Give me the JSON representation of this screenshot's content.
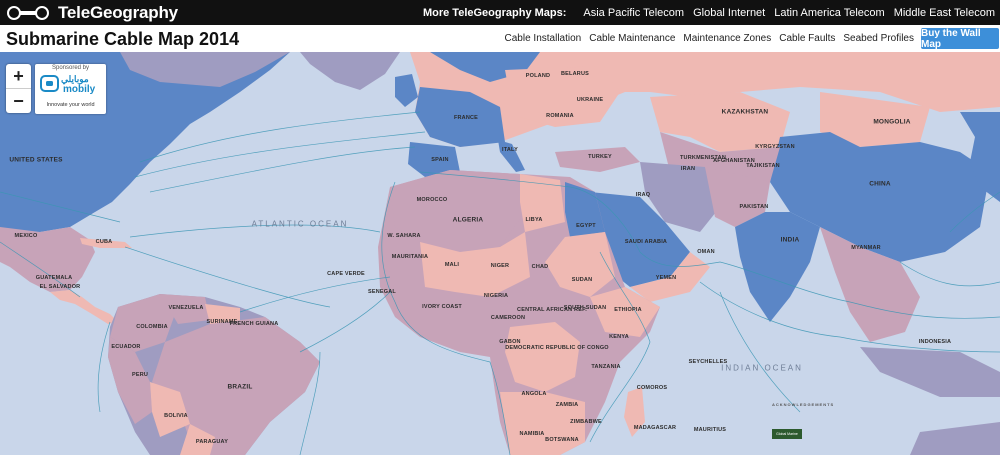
{
  "header": {
    "logo_text": "TeleGeography",
    "more_label": "More TeleGeography Maps:",
    "more_links": [
      "Asia Pacific Telecom",
      "Global Internet",
      "Latin America Telecom",
      "Middle East Telecom"
    ]
  },
  "titlebar": {
    "title": "Submarine Cable Map 2014",
    "tabs": [
      "Cable Installation",
      "Cable Maintenance",
      "Maintenance Zones",
      "Cable Faults",
      "Seabed Profiles"
    ],
    "buy_label": "Buy the Wall Map"
  },
  "map": {
    "zoom_in": "+",
    "zoom_out": "−",
    "sponsor": {
      "label": "Sponsored by",
      "brand_arabic": "موبايلي",
      "brand": "mobily",
      "tagline": "Innovate your world"
    },
    "oceans": [
      "ATLANTIC OCEAN",
      "INDIAN OCEAN"
    ],
    "countries": {
      "united_states": "UNITED STATES",
      "mexico": "MEXICO",
      "cuba": "CUBA",
      "guatemala": "GUATEMALA",
      "el_salvador": "EL SALVADOR",
      "venezuela": "VENEZUELA",
      "colombia": "COLOMBIA",
      "suriname": "SURINAME",
      "french_guiana": "FRENCH GUIANA",
      "ecuador": "ECUADOR",
      "peru": "PERU",
      "brazil": "BRAZIL",
      "bolivia": "BOLIVIA",
      "paraguay": "PARAGUAY",
      "poland": "POLAND",
      "belarus": "BELARUS",
      "ukraine": "UKRAINE",
      "romania": "ROMANIA",
      "france": "FRANCE",
      "spain": "SPAIN",
      "italy": "ITALY",
      "turkey": "TURKEY",
      "kazakhstan": "KAZAKHSTAN",
      "mongolia": "MONGOLIA",
      "china": "CHINA",
      "turkmenistan": "TURKMENISTAN",
      "kyrgyzstan": "KYRGYZSTAN",
      "tajikistan": "TAJIKISTAN",
      "afghanistan": "AFGHANISTAN",
      "iran": "IRAN",
      "iraq": "IRAQ",
      "pakistan": "PAKISTAN",
      "india": "INDIA",
      "myanmar": "MYANMAR",
      "saudi_arabia": "SAUDI ARABIA",
      "yemen": "YEMEN",
      "oman": "OMAN",
      "morocco": "MOROCCO",
      "algeria": "ALGERIA",
      "libya": "LIBYA",
      "egypt": "EGYPT",
      "w_sahara": "W. SAHARA",
      "mauritania": "MAURITANIA",
      "mali": "MALI",
      "niger": "NIGER",
      "chad": "CHAD",
      "sudan": "SUDAN",
      "south_sudan": "SOUTH SUDAN",
      "ethiopia": "ETHIOPIA",
      "nigeria": "NIGERIA",
      "cameroon": "CAMEROON",
      "central_african_rep": "CENTRAL AFRICAN REP.",
      "dr_congo": "DEMOCRATIC REPUBLIC OF CONGO",
      "gabon": "GABON",
      "kenya": "KENYA",
      "tanzania": "TANZANIA",
      "angola": "ANGOLA",
      "zambia": "ZAMBIA",
      "zimbabwe": "ZIMBABWE",
      "botswana": "BOTSWANA",
      "namibia": "NAMIBIA",
      "madagascar": "MADAGASCAR",
      "cape_verde": "CAPE VERDE",
      "ivory_coast": "IVORY COAST",
      "senegal": "SENEGAL",
      "indonesia": "INDONESIA",
      "seychelles": "SEYCHELLES",
      "comoros": "COMOROS",
      "mauritius": "MAURITIUS"
    },
    "acknowledgements": "ACKNOWLEDGEMENTS",
    "global_marine": "Global Marine"
  },
  "colors": {
    "ocean": "#c9d6ea",
    "pink": "#efb9b3",
    "mauve": "#c7a3b8",
    "slate": "#9f9cc1",
    "blue": "#5b86c6",
    "cable": "#3c96b4",
    "topbar": "#111111",
    "button": "#3d8fd9"
  }
}
